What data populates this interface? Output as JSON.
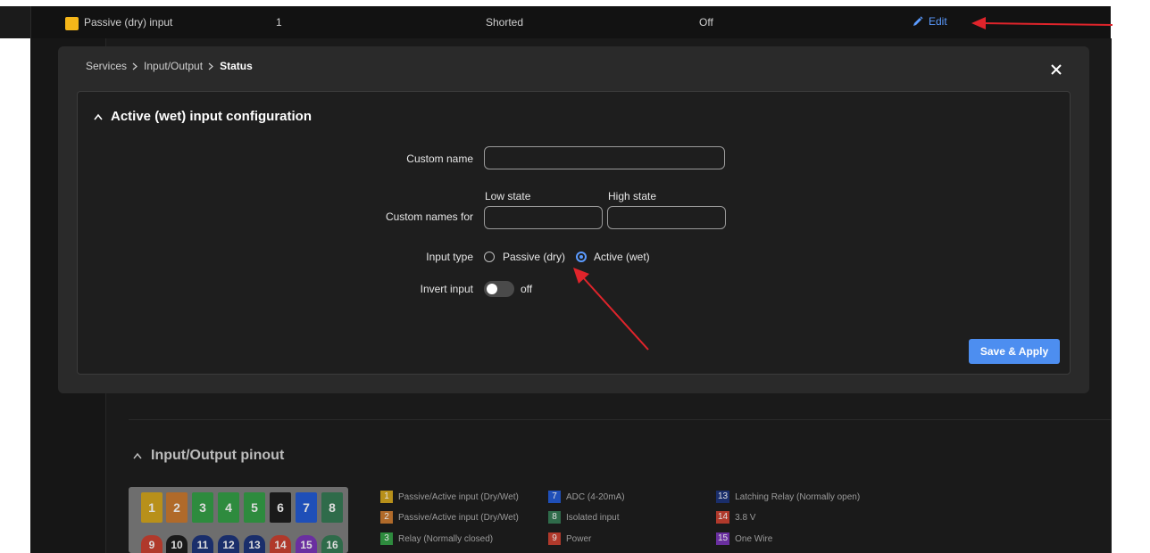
{
  "top_row": {
    "name": "Passive (dry) input",
    "index": "1",
    "state": "Shorted",
    "invert": "Off",
    "edit_label": "Edit",
    "swatch_color": "#f5b619"
  },
  "modal": {
    "breadcrumb": [
      "Services",
      "Input/Output",
      "Status"
    ],
    "panel_title": "Active (wet) input configuration",
    "custom_name_label": "Custom name",
    "custom_name_value": "",
    "custom_names_label": "Custom names for",
    "low_state_label": "Low state",
    "high_state_label": "High state",
    "low_state_value": "",
    "high_state_value": "",
    "input_type_label": "Input type",
    "input_type_options": [
      "Passive (dry)",
      "Active (wet)"
    ],
    "input_type_selected": "Active (wet)",
    "invert_label": "Invert input",
    "invert_state": "off",
    "save_label": "Save & Apply"
  },
  "pinout": {
    "title": "Input/Output pinout",
    "pins_top": [
      "1",
      "2",
      "3",
      "4",
      "5",
      "6",
      "7",
      "8"
    ],
    "pins_bottom": [
      "9",
      "10",
      "11",
      "12",
      "13",
      "14",
      "15",
      "16"
    ],
    "legend": [
      {
        "num": "1",
        "label": "Passive/Active input (Dry/Wet)",
        "color": "#b8901a"
      },
      {
        "num": "2",
        "label": "Passive/Active input (Dry/Wet)",
        "color": "#b06a2a"
      },
      {
        "num": "3",
        "label": "Relay (Normally closed)",
        "color": "#2e8b3e"
      },
      {
        "num": "7",
        "label": "ADC (4-20mA)",
        "color": "#1f4fb8"
      },
      {
        "num": "8",
        "label": "Isolated input",
        "color": "#2f6b4a"
      },
      {
        "num": "9",
        "label": "Power",
        "color": "#b0392b"
      },
      {
        "num": "13",
        "label": "Latching Relay (Normally open)",
        "color": "#1a2e6b"
      },
      {
        "num": "14",
        "label": "3.8 V",
        "color": "#b0392b"
      },
      {
        "num": "15",
        "label": "One Wire",
        "color": "#6a2fa0"
      }
    ]
  },
  "colors": {
    "accent": "#4d8ef0",
    "annotation_arrow": "#e0242b"
  }
}
